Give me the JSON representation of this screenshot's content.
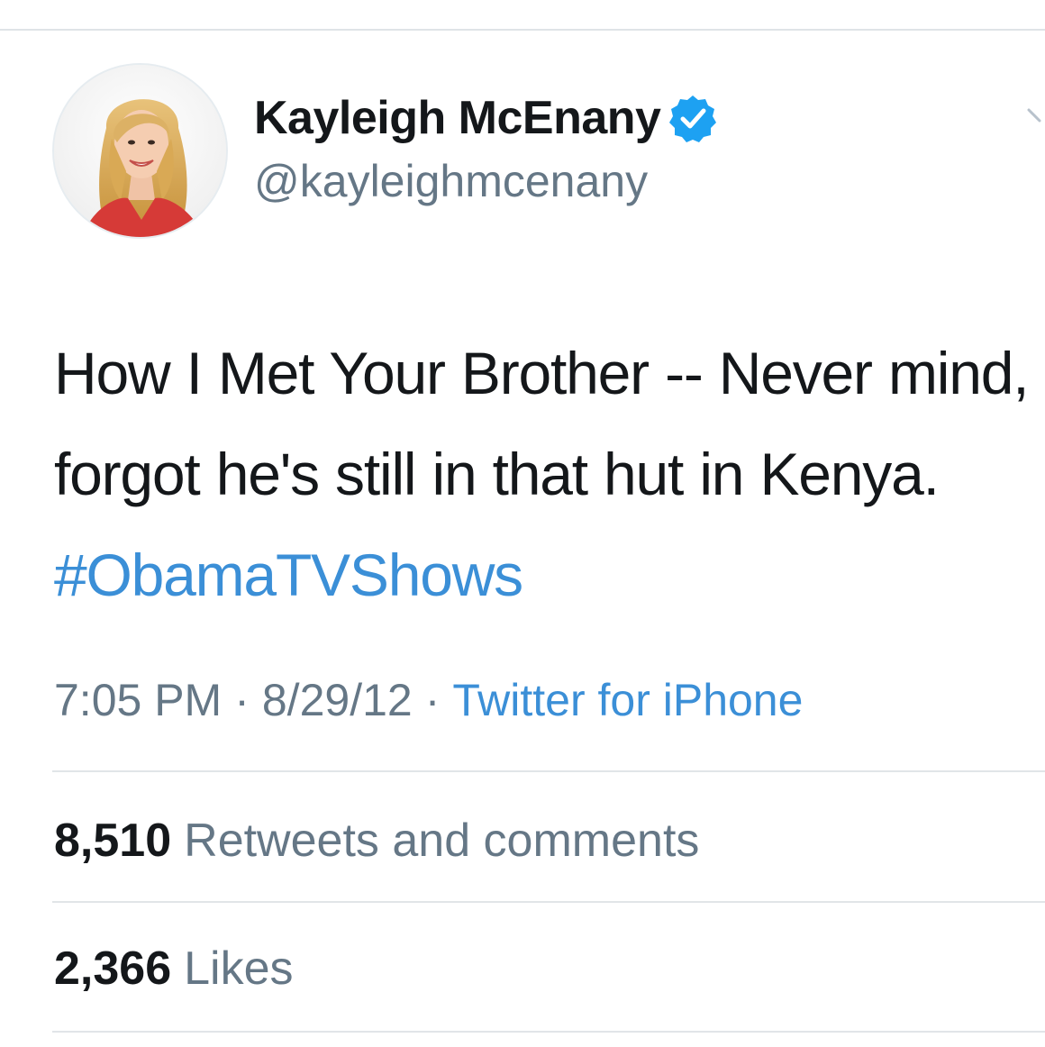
{
  "tweet": {
    "author": {
      "display_name": "Kayleigh McEnany",
      "handle": "@kayleighmcenany",
      "verified": true
    },
    "text_plain": "How I Met Your Brother -- Never mind, forgot he's still in that hut in Kenya.",
    "hashtag": "#ObamaTVShows",
    "meta": {
      "time": "7:05 PM",
      "separator": "·",
      "date": "8/29/12",
      "source": "Twitter for iPhone"
    },
    "stats": {
      "retweets_count": "8,510",
      "retweets_label": "Retweets and comments",
      "likes_count": "2,366",
      "likes_label": "Likes"
    }
  },
  "colors": {
    "link": "#3b8fd7",
    "secondary_text": "#657786",
    "primary_text": "#14171a",
    "verified_badge": "#1da1f2"
  },
  "icons": {
    "verified": "verified-badge-icon",
    "more": "chevron-down-icon"
  }
}
